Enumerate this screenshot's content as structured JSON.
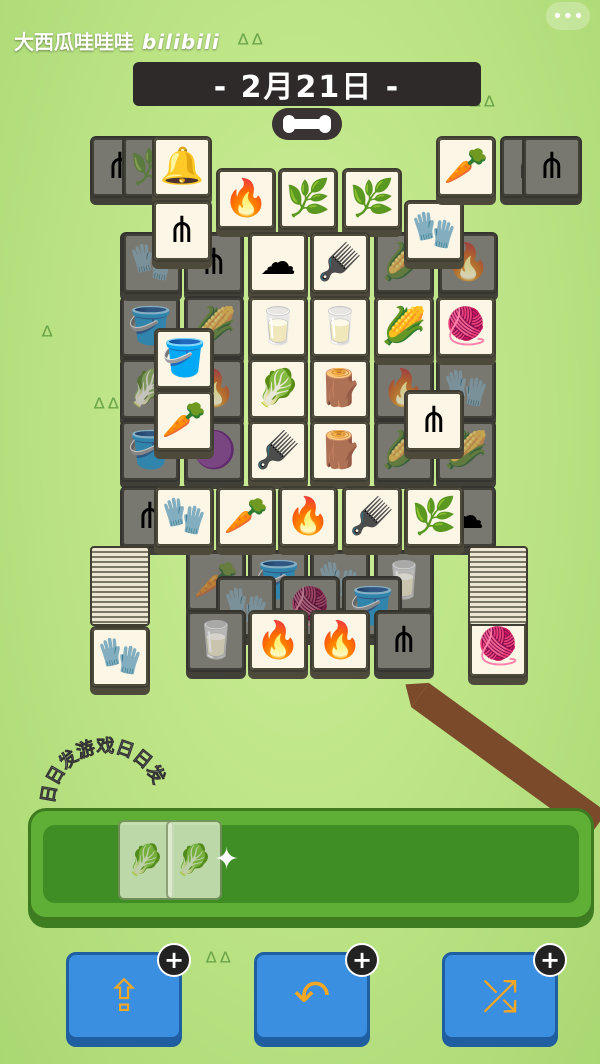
{
  "header": {
    "uploader": "大西瓜哇哇哇",
    "platform_logo": "bilibili",
    "more_icon": "ellipsis-icon"
  },
  "game": {
    "date_label": "- 2月21日 -",
    "progress_icon": "bone-icon"
  },
  "board": {
    "tiles": [
      {
        "id": "t1",
        "icon": "rake-icon",
        "sym": "⋔",
        "dim": true
      },
      {
        "id": "t2",
        "icon": "grass-icon",
        "sym": "🌿",
        "dim": true
      },
      {
        "id": "t3",
        "icon": "bell-icon",
        "sym": "🔔",
        "dim": false
      },
      {
        "id": "t4",
        "icon": "rake-icon",
        "sym": "⋔",
        "dim": false
      },
      {
        "id": "t5",
        "icon": "campfire-icon",
        "sym": "🔥",
        "dim": false
      },
      {
        "id": "t6",
        "icon": "grass-icon",
        "sym": "🌿",
        "dim": false
      },
      {
        "id": "t7",
        "icon": "grass-icon",
        "sym": "🌿",
        "dim": false
      },
      {
        "id": "t8",
        "icon": "glove-icon",
        "sym": "🧤",
        "dim": false
      },
      {
        "id": "t9",
        "icon": "carrot-icon",
        "sym": "🥕",
        "dim": false
      },
      {
        "id": "t10",
        "icon": "rake-icon",
        "sym": "⋔",
        "dim": true
      },
      {
        "id": "t11",
        "icon": "brush-icon",
        "sym": "🪮",
        "dim": true
      },
      {
        "id": "t12",
        "icon": "rake-icon",
        "sym": "⋔",
        "dim": true
      },
      {
        "id": "t13",
        "icon": "wool-icon",
        "sym": "☁",
        "dim": false
      },
      {
        "id": "t14",
        "icon": "brush-icon",
        "sym": "🪮",
        "dim": false
      },
      {
        "id": "t15",
        "icon": "corn-icon",
        "sym": "🌽",
        "dim": true
      },
      {
        "id": "t16",
        "icon": "campfire-icon",
        "sym": "🔥",
        "dim": true
      },
      {
        "id": "t17",
        "icon": "bucket-icon",
        "sym": "🪣",
        "dim": true
      },
      {
        "id": "t18",
        "icon": "corn-icon",
        "sym": "🌽",
        "dim": true
      },
      {
        "id": "t19",
        "icon": "milk-jar-icon",
        "sym": "🥛",
        "dim": false
      },
      {
        "id": "t20",
        "icon": "milk-jar-icon",
        "sym": "🥛",
        "dim": false
      },
      {
        "id": "t21",
        "icon": "corn-icon",
        "sym": "🌽",
        "dim": false
      },
      {
        "id": "t22",
        "icon": "yarn-ball-icon",
        "sym": "🧶",
        "dim": false
      },
      {
        "id": "t23",
        "icon": "bucket-icon",
        "sym": "🪣",
        "dim": false
      },
      {
        "id": "t24",
        "icon": "cabbage-icon",
        "sym": "🥬",
        "dim": true
      },
      {
        "id": "t25",
        "icon": "campfire-icon",
        "sym": "🔥",
        "dim": true
      },
      {
        "id": "t26",
        "icon": "cabbage-icon",
        "sym": "🥬",
        "dim": false
      },
      {
        "id": "t27",
        "icon": "stump-icon",
        "sym": "🪵",
        "dim": false
      },
      {
        "id": "t28",
        "icon": "campfire-icon",
        "sym": "🔥",
        "dim": true
      },
      {
        "id": "t29",
        "icon": "glove-icon",
        "sym": "🧤",
        "dim": true
      },
      {
        "id": "t30",
        "icon": "carrot-icon",
        "sym": "🥕",
        "dim": false
      },
      {
        "id": "t31",
        "icon": "bucket-icon",
        "sym": "🪣",
        "dim": true
      },
      {
        "id": "t32",
        "icon": "cabbage-icon",
        "sym": "🟣",
        "dim": true
      },
      {
        "id": "t33",
        "icon": "brush-icon",
        "sym": "🪮",
        "dim": false
      },
      {
        "id": "t34",
        "icon": "stump-icon",
        "sym": "🪵",
        "dim": false
      },
      {
        "id": "t35",
        "icon": "corn-icon",
        "sym": "🌽",
        "dim": true
      },
      {
        "id": "t36",
        "icon": "rake-icon",
        "sym": "⋔",
        "dim": false
      },
      {
        "id": "t37",
        "icon": "corn-icon",
        "sym": "🌽",
        "dim": true
      },
      {
        "id": "t38",
        "icon": "rake-icon",
        "sym": "⋔",
        "dim": true
      },
      {
        "id": "t39",
        "icon": "glove-icon",
        "sym": "🧤",
        "dim": false
      },
      {
        "id": "t40",
        "icon": "carrot-icon",
        "sym": "🥕",
        "dim": false
      },
      {
        "id": "t41",
        "icon": "campfire-icon",
        "sym": "🔥",
        "dim": false
      },
      {
        "id": "t42",
        "icon": "brush-icon",
        "sym": "🪮",
        "dim": false
      },
      {
        "id": "t43",
        "icon": "grass-icon",
        "sym": "🌿",
        "dim": false
      },
      {
        "id": "t44",
        "icon": "wool-icon",
        "sym": "☁",
        "dim": true
      },
      {
        "id": "t45",
        "icon": "carrot-icon",
        "sym": "🥕",
        "dim": true
      },
      {
        "id": "t46",
        "icon": "bucket-icon",
        "sym": "🪣",
        "dim": true
      },
      {
        "id": "t47",
        "icon": "glove-icon",
        "sym": "🧤",
        "dim": true
      },
      {
        "id": "t48",
        "icon": "milk-jar-icon",
        "sym": "🥛",
        "dim": true
      },
      {
        "id": "t49",
        "icon": "glove-icon",
        "sym": "🧤",
        "dim": true
      },
      {
        "id": "t50",
        "icon": "yarn-ball-icon",
        "sym": "🧶",
        "dim": true
      },
      {
        "id": "t51",
        "icon": "bucket-icon",
        "sym": "🪣",
        "dim": true
      },
      {
        "id": "t52",
        "icon": "milk-jar-icon",
        "sym": "🥛",
        "dim": true
      },
      {
        "id": "t53",
        "icon": "campfire-icon",
        "sym": "🔥",
        "dim": false
      },
      {
        "id": "t54",
        "icon": "campfire-icon",
        "sym": "🔥",
        "dim": false
      },
      {
        "id": "t55",
        "icon": "rake-icon",
        "sym": "⋔",
        "dim": true
      },
      {
        "id": "t56",
        "icon": "glove-icon",
        "sym": "🧤",
        "dim": false
      },
      {
        "id": "t57",
        "icon": "yarn-ball-icon",
        "sym": "🧶",
        "dim": false
      },
      {
        "id": "t58",
        "icon": "rake-icon",
        "sym": "⋔",
        "dim": true
      },
      {
        "id": "t59",
        "icon": "glove-icon",
        "sym": "🧤",
        "dim": true
      }
    ]
  },
  "tray": {
    "slots": [
      {
        "icon": "cabbage-icon",
        "sym": "🥬"
      },
      {
        "icon": "cabbage-icon",
        "sym": "🥬"
      }
    ],
    "sparkle_icon": "sparkle-icon"
  },
  "tools": [
    {
      "name": "move-out-tool",
      "icon": "move-out-icon",
      "sym": "⇪",
      "badge": "+"
    },
    {
      "name": "undo-tool",
      "icon": "undo-icon",
      "sym": "↶",
      "badge": "+"
    },
    {
      "name": "shuffle-tool",
      "icon": "shuffle-icon",
      "sym": "⤮",
      "badge": "+"
    }
  ],
  "watermark": "日日发游戏日日发"
}
